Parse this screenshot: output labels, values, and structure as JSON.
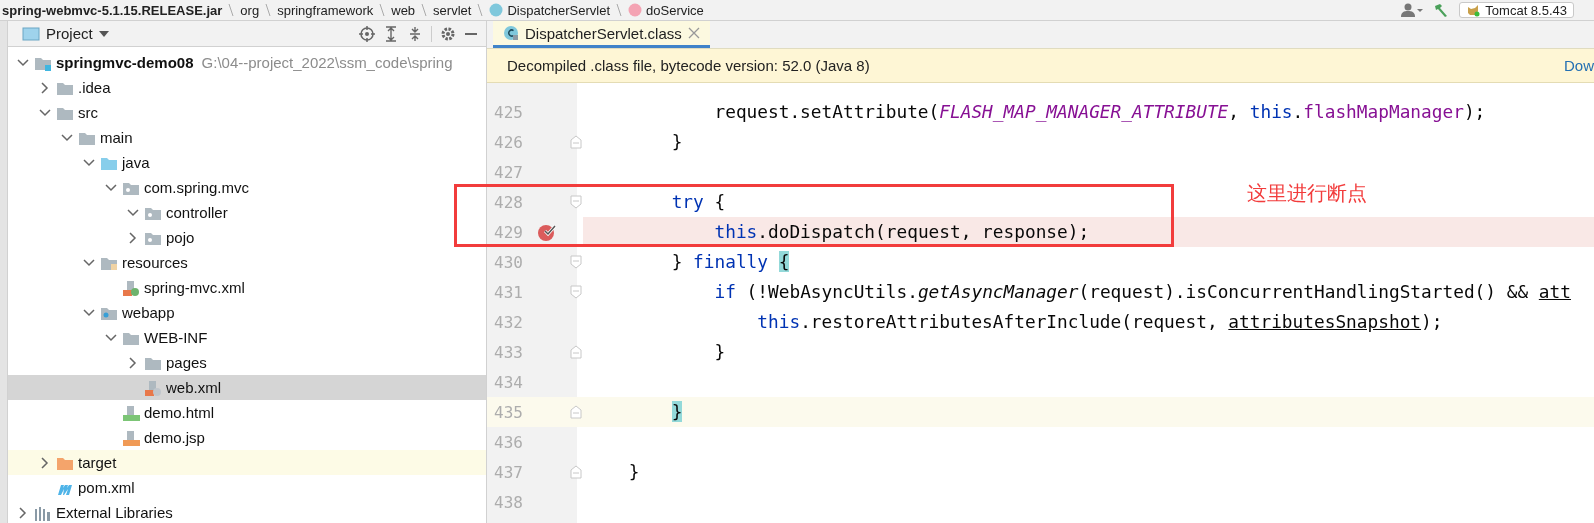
{
  "breadcrumbs": [
    {
      "label": "spring-webmvc-5.1.15.RELEASE.jar",
      "kind": "jar"
    },
    {
      "label": "org",
      "kind": "package"
    },
    {
      "label": "springframework",
      "kind": "package"
    },
    {
      "label": "web",
      "kind": "package"
    },
    {
      "label": "servlet",
      "kind": "package"
    },
    {
      "label": "DispatcherServlet",
      "kind": "class"
    },
    {
      "label": "doService",
      "kind": "method"
    }
  ],
  "toolbar": {
    "run_config": "Tomcat 8.5.43"
  },
  "project_panel": {
    "title": "Project",
    "tree": [
      {
        "label": "springmvc-demo08",
        "path": "G:\\04--project_2022\\ssm_code\\spring",
        "kind": "module",
        "expanded": true,
        "selected": false,
        "hovered": false,
        "children": [
          {
            "label": ".idea",
            "kind": "folder",
            "expanded": false,
            "selected": false,
            "hovered": false
          },
          {
            "label": "src",
            "kind": "folder",
            "expanded": true,
            "selected": false,
            "hovered": false,
            "children": [
              {
                "label": "main",
                "kind": "folder",
                "expanded": true,
                "selected": false,
                "hovered": false,
                "children": [
                  {
                    "label": "java",
                    "kind": "source-folder",
                    "expanded": true,
                    "selected": false,
                    "hovered": false,
                    "children": [
                      {
                        "label": "com.spring.mvc",
                        "kind": "package",
                        "expanded": true,
                        "selected": false,
                        "hovered": false,
                        "children": [
                          {
                            "label": "controller",
                            "kind": "package",
                            "expanded": true,
                            "selected": false,
                            "hovered": false
                          },
                          {
                            "label": "pojo",
                            "kind": "package",
                            "expanded": false,
                            "selected": false,
                            "hovered": false
                          }
                        ]
                      }
                    ]
                  },
                  {
                    "label": "resources",
                    "kind": "resources",
                    "expanded": true,
                    "selected": false,
                    "hovered": false,
                    "children": [
                      {
                        "label": "spring-mvc.xml",
                        "kind": "spring-xml",
                        "selected": false,
                        "hovered": false
                      }
                    ]
                  },
                  {
                    "label": "webapp",
                    "kind": "web-folder",
                    "expanded": true,
                    "selected": false,
                    "hovered": false,
                    "children": [
                      {
                        "label": "WEB-INF",
                        "kind": "folder",
                        "expanded": true,
                        "selected": false,
                        "hovered": false,
                        "children": [
                          {
                            "label": "pages",
                            "kind": "folder",
                            "expanded": false,
                            "selected": false,
                            "hovered": false
                          },
                          {
                            "label": "web.xml",
                            "kind": "web-xml",
                            "selected": true,
                            "hovered": false
                          }
                        ]
                      },
                      {
                        "label": "demo.html",
                        "kind": "html",
                        "selected": false,
                        "hovered": false
                      },
                      {
                        "label": "demo.jsp",
                        "kind": "jsp",
                        "selected": false,
                        "hovered": false
                      }
                    ]
                  }
                ]
              }
            ]
          },
          {
            "label": "target",
            "kind": "excluded-folder",
            "expanded": false,
            "selected": false,
            "hovered": true
          },
          {
            "label": "pom.xml",
            "kind": "maven",
            "selected": false,
            "hovered": false
          }
        ]
      },
      {
        "label": "External Libraries",
        "kind": "libraries",
        "expanded": false,
        "selected": false,
        "hovered": false
      }
    ]
  },
  "editor": {
    "tab": {
      "label": "DispatcherServlet.class",
      "selected": true
    },
    "notice": "Decompiled .class file, bytecode version: 52.0 (Java 8)",
    "notice_link": "Dow",
    "lines": [
      {
        "number": "425",
        "kind": "plain",
        "breakpoint": false,
        "current": false,
        "tokens": [
          {
            "text": "            request.setAttribute(",
            "kind": "plain"
          },
          {
            "text": "FLASH_MAP_MANAGER_ATTRIBUTE",
            "kind": "constant"
          },
          {
            "text": ", ",
            "kind": "plain"
          },
          {
            "text": "this",
            "kind": "keyword"
          },
          {
            "text": ".",
            "kind": "plain"
          },
          {
            "text": "flashMapManager",
            "kind": "field"
          },
          {
            "text": ");",
            "kind": "plain"
          }
        ]
      },
      {
        "number": "426",
        "kind": "fold-end",
        "breakpoint": false,
        "current": false,
        "tokens": [
          {
            "text": "        }",
            "kind": "plain"
          }
        ]
      },
      {
        "number": "427",
        "kind": "plain",
        "breakpoint": false,
        "current": false
      },
      {
        "number": "428",
        "kind": "fold-start",
        "breakpoint": false,
        "current": false,
        "tokens": [
          {
            "text": "        try",
            "kind": "keyword"
          },
          {
            "text": " {",
            "kind": "plain"
          }
        ]
      },
      {
        "number": "429",
        "kind": "plain",
        "breakpoint": true,
        "current": false,
        "tokens": [
          {
            "text": "            this",
            "kind": "keyword"
          },
          {
            "text": ".doDispatch(request, response);",
            "kind": "plain"
          }
        ]
      },
      {
        "number": "430",
        "kind": "fold-start",
        "breakpoint": false,
        "current": false,
        "tokens": [
          {
            "text": "        } ",
            "kind": "plain"
          },
          {
            "text": "finally ",
            "kind": "keyword"
          },
          {
            "text": "{",
            "kind": "brace-match"
          }
        ]
      },
      {
        "number": "431",
        "kind": "fold-start",
        "breakpoint": false,
        "current": false,
        "tokens": [
          {
            "text": "            if",
            "kind": "keyword"
          },
          {
            "text": " (!WebAsyncUtils.",
            "kind": "plain"
          },
          {
            "text": "getAsyncManager",
            "kind": "static-call"
          },
          {
            "text": "(request).isConcurrentHandlingStarted() && ",
            "kind": "plain"
          },
          {
            "text": "att",
            "kind": "underlined"
          }
        ]
      },
      {
        "number": "432",
        "kind": "plain",
        "breakpoint": false,
        "current": false,
        "tokens": [
          {
            "text": "                this",
            "kind": "keyword"
          },
          {
            "text": ".restoreAttributesAfterInclude(request, ",
            "kind": "plain"
          },
          {
            "text": "attributesSnapshot",
            "kind": "underlined"
          },
          {
            "text": ");",
            "kind": "plain"
          }
        ]
      },
      {
        "number": "433",
        "kind": "fold-end",
        "breakpoint": false,
        "current": false,
        "tokens": [
          {
            "text": "            }",
            "kind": "plain"
          }
        ]
      },
      {
        "number": "434",
        "kind": "plain",
        "breakpoint": false,
        "current": false
      },
      {
        "number": "435",
        "kind": "fold-end",
        "breakpoint": false,
        "current": true,
        "tokens": [
          {
            "text": "        }",
            "kind": "brace-match"
          }
        ]
      },
      {
        "number": "436",
        "kind": "plain",
        "breakpoint": false,
        "current": false
      },
      {
        "number": "437",
        "kind": "fold-end",
        "breakpoint": false,
        "current": false,
        "tokens": [
          {
            "text": "    }",
            "kind": "plain"
          }
        ]
      },
      {
        "number": "438",
        "kind": "plain",
        "breakpoint": false,
        "current": false
      }
    ]
  },
  "annotation": {
    "text": "这里进行断点"
  }
}
